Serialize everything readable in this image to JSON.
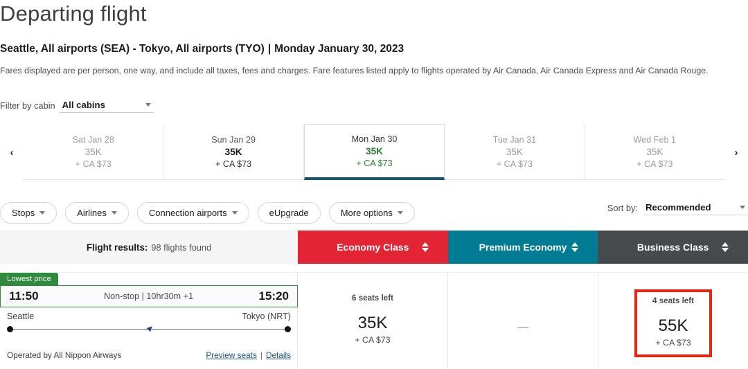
{
  "header": {
    "title": "Departing flight",
    "route_summary": "Seattle, All airports (SEA) - Tokyo, All airports (TYO)",
    "separator": "|",
    "date_label": "Monday January 30, 2023",
    "fare_note": "Fares displayed are per person, one way, and include all taxes, fees and charges. Fare features listed apply to flights operated by Air Canada, Air Canada Express and Air Canada Rouge."
  },
  "cabin_filter": {
    "label": "Filter by cabin",
    "value": "All cabins",
    "caret": "chevron-down-icon"
  },
  "date_strip": {
    "prev_arrow": "‹",
    "next_arrow": "›",
    "days": [
      {
        "day": "Sat Jan 28",
        "points": "35K",
        "tax": "+ CA $73",
        "state": "dim"
      },
      {
        "day": "Sun Jan 29",
        "points": "35K",
        "tax": "+ CA $73",
        "state": "normal"
      },
      {
        "day": "Mon Jan 30",
        "points": "35K",
        "tax": "+ CA $73",
        "state": "selected"
      },
      {
        "day": "Tue Jan 31",
        "points": "35K",
        "tax": "+ CA $73",
        "state": "dim"
      },
      {
        "day": "Wed Feb 1",
        "points": "35K",
        "tax": "+ CA $73",
        "state": "dim"
      }
    ]
  },
  "filters": [
    {
      "label": "Stops",
      "has_caret": true
    },
    {
      "label": "Airlines",
      "has_caret": true
    },
    {
      "label": "Connection airports",
      "has_caret": true
    },
    {
      "label": "eUpgrade",
      "has_caret": false
    },
    {
      "label": "More options",
      "has_caret": true
    }
  ],
  "sort": {
    "label": "Sort by:",
    "value": "Recommended"
  },
  "results_bar": {
    "label": "Flight results:",
    "count": "98 flights found"
  },
  "classes": [
    {
      "name": "Economy Class",
      "color": "#e32434"
    },
    {
      "name": "Premium Economy",
      "color": "#007b94"
    },
    {
      "name": "Business Class",
      "color": "#474a4d"
    }
  ],
  "flight": {
    "badge": "Lowest price",
    "depart_time": "11:50",
    "arrive_time": "15:20",
    "stops_duration": "Non-stop | 10hr30m +1",
    "origin": "Seattle",
    "destination": "Tokyo (NRT)",
    "operated_by": "Operated by All Nippon Airways",
    "preview_seats": "Preview seats",
    "link_sep": "|",
    "details": "Details",
    "fares": [
      {
        "seats": "6 seats left",
        "points": "35K",
        "tax": "+ CA $73",
        "available": true,
        "highlighted": false
      },
      {
        "seats": "",
        "points": "—",
        "tax": "",
        "available": false,
        "highlighted": false
      },
      {
        "seats": "4 seats left",
        "points": "55K",
        "tax": "+ CA $73",
        "available": true,
        "highlighted": true
      }
    ]
  },
  "colors": {
    "economy": "#e32434",
    "premium_economy": "#007b94",
    "business": "#474a4d",
    "lowest_price_green": "#2e8b3d",
    "selected_tab_underline": "#14566b",
    "highlight_box": "#ee2211"
  }
}
